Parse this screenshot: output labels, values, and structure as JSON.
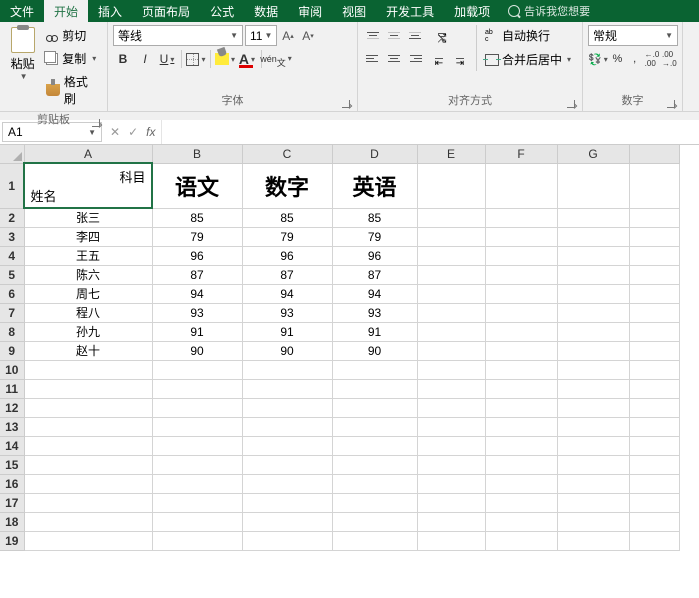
{
  "tabs": [
    "文件",
    "开始",
    "插入",
    "页面布局",
    "公式",
    "数据",
    "审阅",
    "视图",
    "开发工具",
    "加载项"
  ],
  "active_tab": 1,
  "tell_me": "告诉我您想要",
  "clipboard": {
    "paste": "粘贴",
    "cut": "剪切",
    "copy": "复制",
    "format": "格式刷",
    "label": "剪贴板"
  },
  "font": {
    "name": "等线",
    "size": "11",
    "bold": "B",
    "italic": "I",
    "underline": "U",
    "wen": "wén",
    "label": "字体"
  },
  "alignment": {
    "wrap": "自动换行",
    "merge": "合并后居中",
    "label": "对齐方式"
  },
  "number": {
    "format": "常规",
    "percent": "%",
    "comma": ",",
    "dec_inc": ".0",
    "dec_dec": ".00",
    "label": "数字"
  },
  "namebox": "A1",
  "formula": "",
  "columns": [
    "A",
    "B",
    "C",
    "D",
    "E",
    "F",
    "G"
  ],
  "rows": [
    "1",
    "2",
    "3",
    "4",
    "5",
    "6",
    "7",
    "8",
    "9",
    "10",
    "11",
    "12",
    "13",
    "14",
    "15",
    "16",
    "17",
    "18",
    "19"
  ],
  "cell_A1": {
    "top": "科目",
    "bot": "姓名"
  },
  "headers": {
    "B": "语文",
    "C": "数字",
    "D": "英语"
  },
  "data_rows": [
    {
      "name": "张三",
      "b": "85",
      "c": "85",
      "d": "85"
    },
    {
      "name": "李四",
      "b": "79",
      "c": "79",
      "d": "79"
    },
    {
      "name": "王五",
      "b": "96",
      "c": "96",
      "d": "96"
    },
    {
      "name": "陈六",
      "b": "87",
      "c": "87",
      "d": "87"
    },
    {
      "name": "周七",
      "b": "94",
      "c": "94",
      "d": "94"
    },
    {
      "name": "程八",
      "b": "93",
      "c": "93",
      "d": "93"
    },
    {
      "name": "孙九",
      "b": "91",
      "c": "91",
      "d": "91"
    },
    {
      "name": "赵十",
      "b": "90",
      "c": "90",
      "d": "90"
    }
  ],
  "chart_data": {
    "type": "table",
    "title": "",
    "columns": [
      "姓名",
      "语文",
      "数字",
      "英语"
    ],
    "rows": [
      [
        "张三",
        85,
        85,
        85
      ],
      [
        "李四",
        79,
        79,
        79
      ],
      [
        "王五",
        96,
        96,
        96
      ],
      [
        "陈六",
        87,
        87,
        87
      ],
      [
        "周七",
        94,
        94,
        94
      ],
      [
        "程八",
        93,
        93,
        93
      ],
      [
        "孙九",
        91,
        91,
        91
      ],
      [
        "赵十",
        90,
        90,
        90
      ]
    ]
  }
}
